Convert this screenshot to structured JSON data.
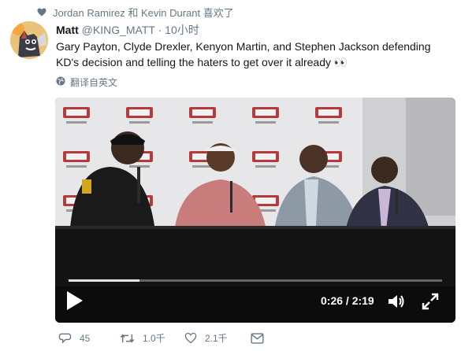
{
  "liked_by": {
    "icon": "heart-icon",
    "text": "Jordan Ramirez 和 Kevin Durant 喜欢了"
  },
  "tweet": {
    "display_name": "Matt",
    "handle": "@KING_MATT",
    "separator": "·",
    "timestamp": "10小时",
    "text": "Gary Payton, Clyde Drexler, Kenyon Martin, and Stephen Jackson defending KD's decision and telling the haters to get over it already 👀",
    "translate_label": "翻译自英文",
    "translate_icon": "globe-icon"
  },
  "video": {
    "backdrop_brand": "BIG3.COM",
    "progress": 0.19,
    "time": "0:26 / 2:19",
    "controls": [
      "play-icon",
      "volume-icon",
      "fullscreen-icon"
    ]
  },
  "actions": {
    "reply_count": "45",
    "retweet_count": "1.0千",
    "like_count": "2.1千",
    "message_icon": "direct-message-icon"
  },
  "colors": {
    "text": "#14171a",
    "muted": "#657786",
    "video_bg": "#2a2a2a"
  }
}
